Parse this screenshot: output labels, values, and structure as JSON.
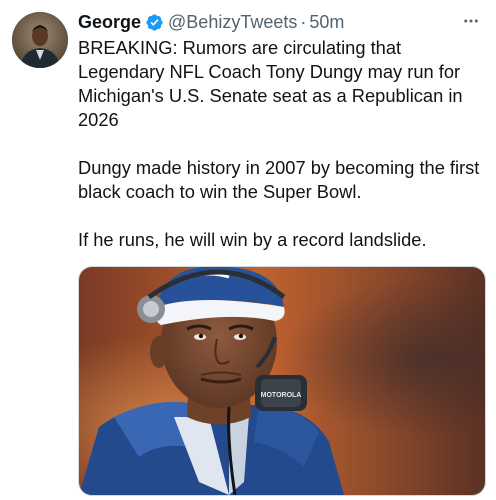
{
  "tweet": {
    "author_name": "George",
    "author_handle": "@BehizyTweets",
    "separator": "·",
    "timestamp": "50m",
    "paragraphs": [
      "BREAKING: Rumors are circulating that Legendary NFL Coach Tony Dungy may run for Michigan's U.S. Senate seat as a Republican in 2026",
      "Dungy made history in 2007 by becoming the first black coach to win the Super Bowl.",
      "If he runs, he will win by a record landslide."
    ],
    "media_headset_brand": "MOTOROLA"
  },
  "icons": {
    "verified": "verified-badge-icon",
    "more": "more-options-icon"
  },
  "colors": {
    "verified_blue": "#1d9bf0",
    "text": "#0f1419",
    "secondary_text": "#536471"
  }
}
